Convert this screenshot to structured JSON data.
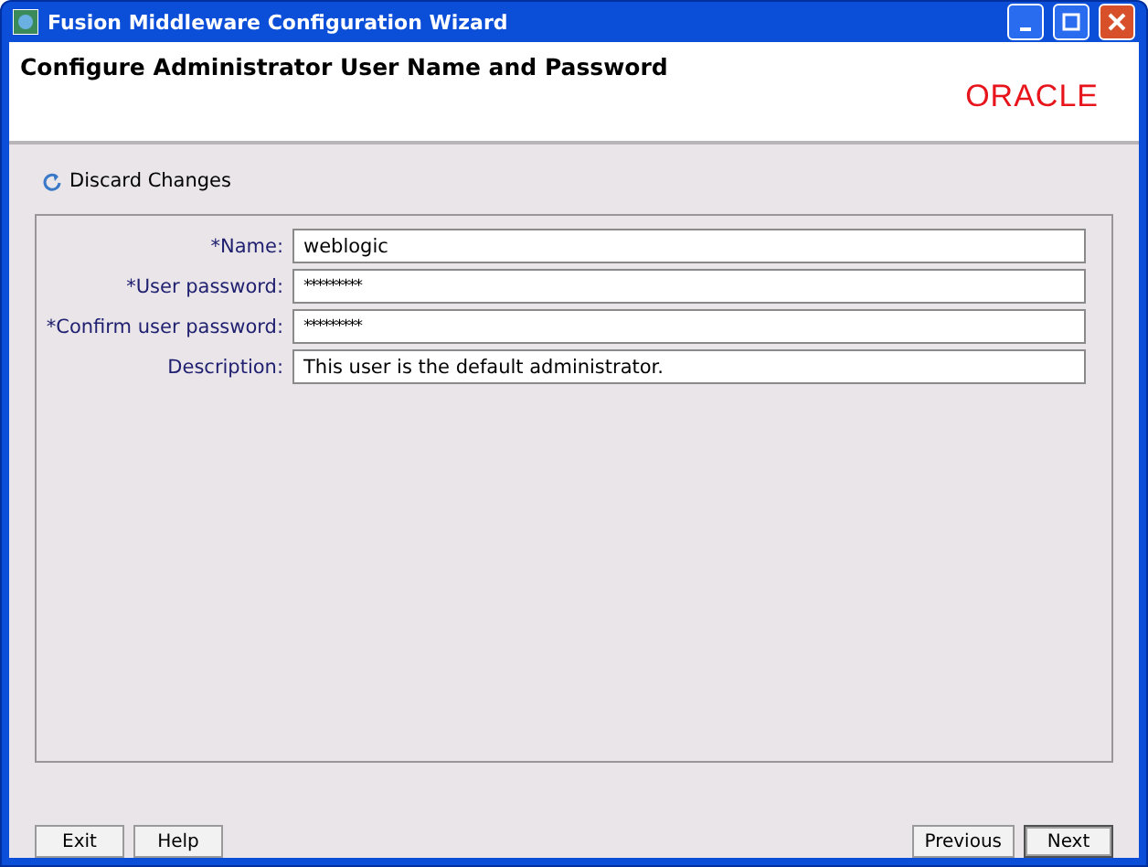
{
  "window": {
    "title": "Fusion Middleware Configuration Wizard"
  },
  "header": {
    "title": "Configure Administrator User Name and Password",
    "logo": "ORACLE"
  },
  "discard": {
    "label": "Discard Changes"
  },
  "fields": [
    {
      "label": "*Name:",
      "value": "weblogic",
      "kind": "text"
    },
    {
      "label": "*User password:",
      "value": "*********",
      "kind": "password"
    },
    {
      "label": "*Confirm user password:",
      "value": "*********",
      "kind": "password"
    },
    {
      "label": "Description:",
      "value": "This user is the default administrator.",
      "kind": "text"
    }
  ],
  "left_buttons": [
    "Exit",
    "Help"
  ],
  "right_buttons": [
    {
      "label": "Previous",
      "default": false
    },
    {
      "label": "Next",
      "default": true
    }
  ]
}
